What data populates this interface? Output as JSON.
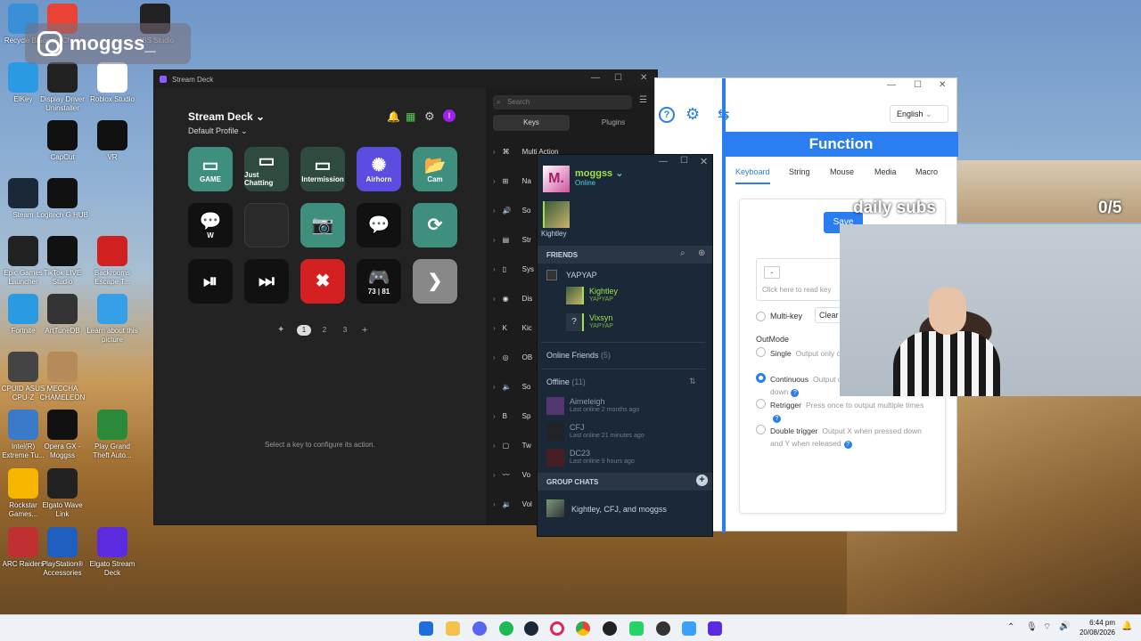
{
  "overlay": {
    "instagram_handle": "moggss_",
    "daily_subs_label": "daily subs",
    "daily_subs_count": "0/5"
  },
  "desktop_icons": [
    {
      "label": "Recycle Bin"
    },
    {
      "label": "Google Chrome"
    },
    {
      "label": "OBS Studio"
    },
    {
      "label": "ElKey"
    },
    {
      "label": "Display Driver Uninstaller"
    },
    {
      "label": "Roblox Studio"
    },
    {
      "label": "CapCut"
    },
    {
      "label": "VR"
    },
    {
      "label": "Steam"
    },
    {
      "label": "Logitech G HUB"
    },
    {
      "label": "Epic Games Launcher"
    },
    {
      "label": "TikTok LIVE Studio"
    },
    {
      "label": "Backrooms Escape T..."
    },
    {
      "label": "Fortnite"
    },
    {
      "label": "ArtTuneDB"
    },
    {
      "label": "Learn about this picture"
    },
    {
      "label": "CPUID ASUS CPU-Z"
    },
    {
      "label": "MECCHA CHAMELEON"
    },
    {
      "label": "Intel(R) Extreme Tu..."
    },
    {
      "label": "Opera GX - Moggss"
    },
    {
      "label": "Play Grand Theft Auto..."
    },
    {
      "label": "Rockstar Games..."
    },
    {
      "label": "Elgato Wave Link"
    },
    {
      "label": "ARC Raiders"
    },
    {
      "label": "PlayStation® Accessories"
    },
    {
      "label": "Elgato Stream Deck"
    }
  ],
  "stream_deck": {
    "window_title": "Stream Deck",
    "device_name": "Stream Deck",
    "profile": "Default Profile",
    "keys": [
      {
        "label": "GAME"
      },
      {
        "label": "Just Chatting"
      },
      {
        "label": "Intermission"
      },
      {
        "label": "Airhorn"
      },
      {
        "label": "Cam"
      },
      {
        "label": "W"
      },
      {
        "label": ""
      },
      {
        "label": ""
      },
      {
        "label": ""
      },
      {
        "label": ""
      },
      {
        "label": ""
      },
      {
        "label": ""
      },
      {
        "label": ""
      },
      {
        "label": "73 | 81"
      },
      {
        "label": ""
      }
    ],
    "pages": [
      "1",
      "2",
      "3"
    ],
    "hint": "Select a key to configure its action.",
    "search_placeholder": "Search",
    "tabs": [
      "Keys",
      "Plugins"
    ],
    "categories": [
      "Multi Action",
      "Na",
      "So",
      "Str",
      "Sys",
      "Dis",
      "Kic",
      "OB",
      "So",
      "Sp",
      "Tw",
      "Vo",
      "Vol"
    ]
  },
  "steam": {
    "username": "moggss",
    "status": "Online",
    "pinned_friend": "Kightley",
    "friends_header": "FRIENDS",
    "group_name": "YAPYAP",
    "group_members": [
      {
        "name": "Kightley",
        "sub": "YAPYAP"
      },
      {
        "name": "Vixsyn",
        "sub": "YAPYAP"
      }
    ],
    "online_section": "Online Friends",
    "online_count": "(5)",
    "offline_section": "Offline",
    "offline_count": "(11)",
    "offline_friends": [
      {
        "name": "Aimeleigh",
        "sub": "Last online 2 months ago"
      },
      {
        "name": "CFJ",
        "sub": "Last online 21 minutes ago"
      },
      {
        "name": "DC23",
        "sub": "Last online 9 hours ago"
      }
    ],
    "group_chats_header": "GROUP CHATS",
    "group_chat": "Kightley, CFJ, and moggss"
  },
  "keyboard_app": {
    "language": "English",
    "function_title": "Function",
    "tabs": [
      "Keyboard",
      "String",
      "Mouse",
      "Media",
      "Macro"
    ],
    "save_label": "Save",
    "key_placeholder": "-",
    "read_key_text": "Click here to read key",
    "multikey_label": "Multi-key",
    "clear_label": "Clear",
    "outmode_label": "OutMode",
    "modes": [
      {
        "name": "Single",
        "desc": "Output only once when held down"
      },
      {
        "name": "Continuous",
        "desc": "Output continuously when held down"
      },
      {
        "name": "Retrigger",
        "desc": "Press once to output multiple times"
      },
      {
        "name": "Double trigger",
        "desc": "Output X when pressed down and Y when released"
      }
    ]
  },
  "taskbar": {
    "time": "6:44 pm",
    "date": "20/08/2026"
  }
}
